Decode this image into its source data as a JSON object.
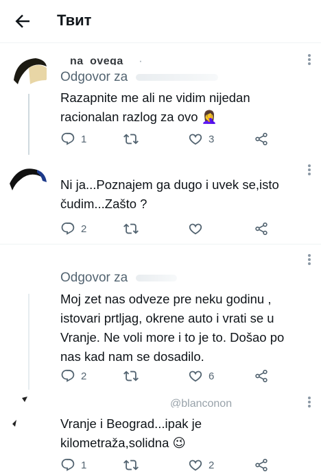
{
  "header": {
    "title": "Твит",
    "back_icon": "arrow-left-icon"
  },
  "tweets": [
    {
      "name_fragment": "na_ovega",
      "reply_to_label": "Odgovor za",
      "text": "Razapnite me ali ne vidim nijedan\nracionalan razlog za ovo 🤦‍♀️",
      "reply_count": "1",
      "retweet_count": "",
      "like_count": "3"
    },
    {
      "name_fragment": "",
      "reply_to_label": "",
      "text": "Ni ja...Poznajem ga dugo i uvek se,isto\nčudim...Zašto ?",
      "reply_count": "2",
      "retweet_count": "",
      "like_count": ""
    },
    {
      "name_fragment": "",
      "reply_to_label": "Odgovor za",
      "text": "Moj zet nas odveze pre neku godinu ,\nistovari  prtljag,  okrene auto i vrati se u\nVranje. Ne voli more i to je to. Došao po\nnas kad nam se dosadilo.",
      "reply_count": "2",
      "retweet_count": "",
      "like_count": "6"
    },
    {
      "name_fragment": "@blanconon",
      "reply_to_label": "",
      "text": "Vranje i Beograd...ipak je\nkilometraža,solidna 😉",
      "reply_count": "1",
      "retweet_count": "",
      "like_count": "2"
    }
  ],
  "icons": {
    "reply": "reply-icon",
    "retweet": "retweet-icon",
    "like": "heart-icon",
    "share": "share-icon",
    "more": "more-icon"
  },
  "colors": {
    "text": "#0f1419",
    "secondary": "#536471",
    "divider": "#eff3f4",
    "thread_line": "#cfd9de"
  }
}
